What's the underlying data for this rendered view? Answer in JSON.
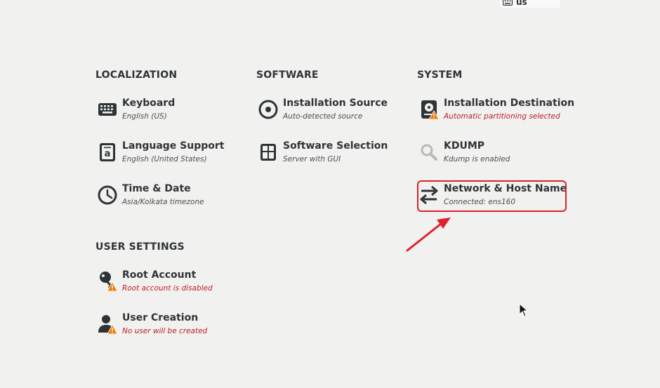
{
  "keyboard_indicator": {
    "label": "us",
    "icon": "keyboard-icon"
  },
  "sections": {
    "localization": {
      "title": "LOCALIZATION"
    },
    "software": {
      "title": "SOFTWARE"
    },
    "system": {
      "title": "SYSTEM"
    },
    "user_settings": {
      "title": "USER SETTINGS"
    }
  },
  "spokes": {
    "keyboard": {
      "title": "Keyboard",
      "status": "English (US)",
      "icon": "keyboard-icon"
    },
    "language": {
      "title": "Language Support",
      "status": "English (United States)",
      "icon": "language-icon"
    },
    "time_date": {
      "title": "Time & Date",
      "status": "Asia/Kolkata timezone",
      "icon": "clock-icon"
    },
    "installation_source": {
      "title": "Installation Source",
      "status": "Auto-detected source",
      "icon": "disc-icon"
    },
    "software_selection": {
      "title": "Software Selection",
      "status": "Server with GUI",
      "icon": "package-icon"
    },
    "installation_destination": {
      "title": "Installation Destination",
      "status": "Automatic partitioning selected",
      "icon": "harddisk-warning-icon"
    },
    "kdump": {
      "title": "KDUMP",
      "status": "Kdump is enabled",
      "icon": "magnifier-icon"
    },
    "network": {
      "title": "Network & Host Name",
      "status": "Connected: ens160",
      "icon": "network-arrows-icon"
    },
    "root_account": {
      "title": "Root Account",
      "status": "Root account is disabled",
      "icon": "key-warning-icon"
    },
    "user_creation": {
      "title": "User Creation",
      "status": "No user will be created",
      "icon": "user-warning-icon"
    }
  },
  "colors": {
    "background": "#f1f1ef",
    "text": "#2e3436",
    "warning_text": "#c01c28",
    "annotation": "#e0202c",
    "warning_badge": "#f57900"
  }
}
